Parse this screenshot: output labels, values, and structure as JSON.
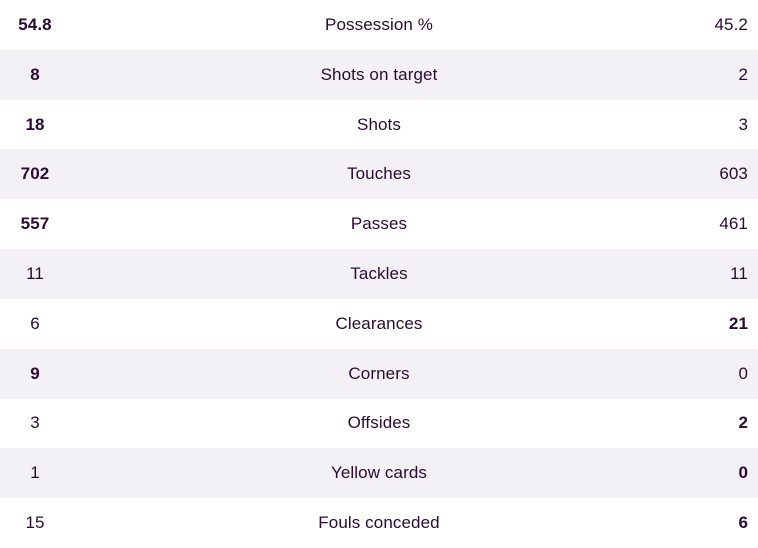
{
  "table": {
    "colors": {
      "text": "#2b0a33",
      "row_background": "#ffffff",
      "row_background_alt": "#f3f1f5"
    },
    "rows": [
      {
        "home": "54.8",
        "label": "Possession %",
        "away": "45.2",
        "home_bold": true,
        "away_bold": false,
        "alt": false
      },
      {
        "home": "8",
        "label": "Shots on target",
        "away": "2",
        "home_bold": true,
        "away_bold": false,
        "alt": true
      },
      {
        "home": "18",
        "label": "Shots",
        "away": "3",
        "home_bold": true,
        "away_bold": false,
        "alt": false
      },
      {
        "home": "702",
        "label": "Touches",
        "away": "603",
        "home_bold": true,
        "away_bold": false,
        "alt": true
      },
      {
        "home": "557",
        "label": "Passes",
        "away": "461",
        "home_bold": true,
        "away_bold": false,
        "alt": false
      },
      {
        "home": "11",
        "label": "Tackles",
        "away": "11",
        "home_bold": false,
        "away_bold": false,
        "alt": true
      },
      {
        "home": "6",
        "label": "Clearances",
        "away": "21",
        "home_bold": false,
        "away_bold": true,
        "alt": false
      },
      {
        "home": "9",
        "label": "Corners",
        "away": "0",
        "home_bold": true,
        "away_bold": false,
        "alt": true
      },
      {
        "home": "3",
        "label": "Offsides",
        "away": "2",
        "home_bold": false,
        "away_bold": true,
        "alt": false
      },
      {
        "home": "1",
        "label": "Yellow cards",
        "away": "0",
        "home_bold": false,
        "away_bold": true,
        "alt": true
      },
      {
        "home": "15",
        "label": "Fouls conceded",
        "away": "6",
        "home_bold": false,
        "away_bold": true,
        "alt": false
      }
    ]
  }
}
